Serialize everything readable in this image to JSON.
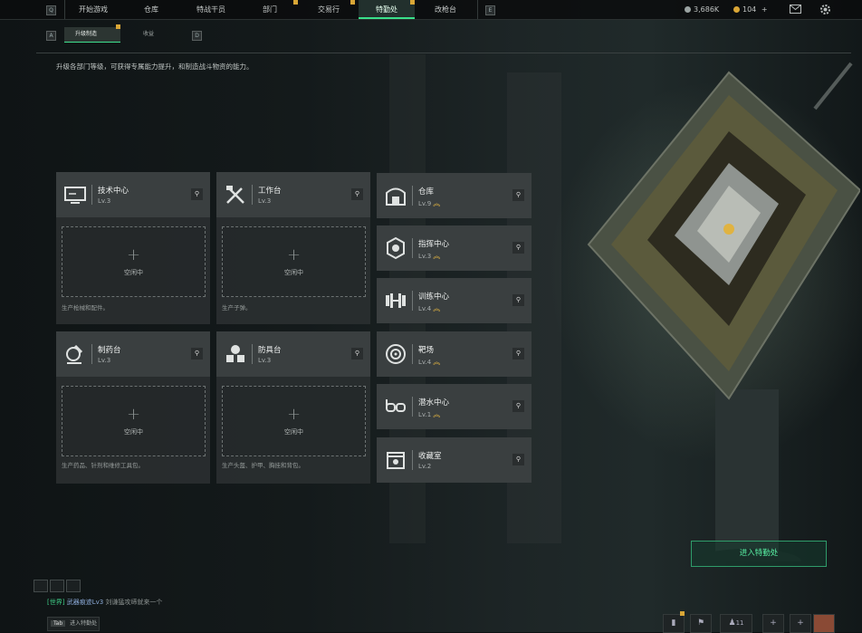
{
  "nav": {
    "key_left": "Q",
    "key_right": "E",
    "tabs": [
      {
        "label": "开始游戏",
        "active": false
      },
      {
        "label": "仓库",
        "active": false
      },
      {
        "label": "特战干员",
        "active": false
      },
      {
        "label": "部门",
        "active": false,
        "badge": true
      },
      {
        "label": "交易行",
        "active": false,
        "badge": true
      },
      {
        "label": "特勤处",
        "active": true,
        "badge": true
      },
      {
        "label": "改枪台",
        "active": false
      }
    ],
    "currency_a": "3,686K",
    "currency_b": "104",
    "currency_b_add": "+"
  },
  "subnav": {
    "key_left": "A",
    "key_right": "D",
    "tabs": [
      {
        "label": "升级制造",
        "active": true
      },
      {
        "label": "收益",
        "active": false
      }
    ]
  },
  "description": "升级各部门等级，可获得专属能力提升，和制造战斗物资的能力。",
  "idle_label": "空闲中",
  "craft_stations": [
    {
      "name": "技术中心",
      "level": "Lv.3",
      "produce": "生产枪械和配件。",
      "icon": "monitor-icon"
    },
    {
      "name": "工作台",
      "level": "Lv.3",
      "produce": "生产子弹。",
      "icon": "tools-icon"
    },
    {
      "name": "制药台",
      "level": "Lv.3",
      "produce": "生产药品、针剂和维修工具包。",
      "icon": "microscope-icon"
    },
    {
      "name": "防具台",
      "level": "Lv.3",
      "produce": "生产头盔、护甲、胸挂和背包。",
      "icon": "armor-parts-icon"
    }
  ],
  "facilities": [
    {
      "name": "仓库",
      "level": "Lv.9",
      "upgradable": true,
      "icon": "warehouse-icon"
    },
    {
      "name": "指挥中心",
      "level": "Lv.3",
      "upgradable": true,
      "icon": "command-gear-icon"
    },
    {
      "name": "训练中心",
      "level": "Lv.4",
      "upgradable": true,
      "icon": "dumbbell-icon"
    },
    {
      "name": "靶场",
      "level": "Lv.4",
      "upgradable": true,
      "icon": "target-icon"
    },
    {
      "name": "潜水中心",
      "level": "Lv.1",
      "upgradable": true,
      "icon": "diving-goggles-icon"
    },
    {
      "name": "收藏室",
      "level": "Lv.2",
      "upgradable": false,
      "icon": "collection-icon"
    }
  ],
  "enter_button": "进入特勤处",
  "chat": {
    "channel": "[世界]",
    "name": "武器痕迹Lv3",
    "message": "刘谦猛攻缔就来一个"
  },
  "bottom_hint": {
    "key": "Tab",
    "label": "进入特勤处"
  },
  "bottom_bar": {
    "friends_count": "11"
  },
  "colors": {
    "accent": "#39e08a",
    "badge": "#d9a636",
    "upgrade": "#e0b341"
  }
}
